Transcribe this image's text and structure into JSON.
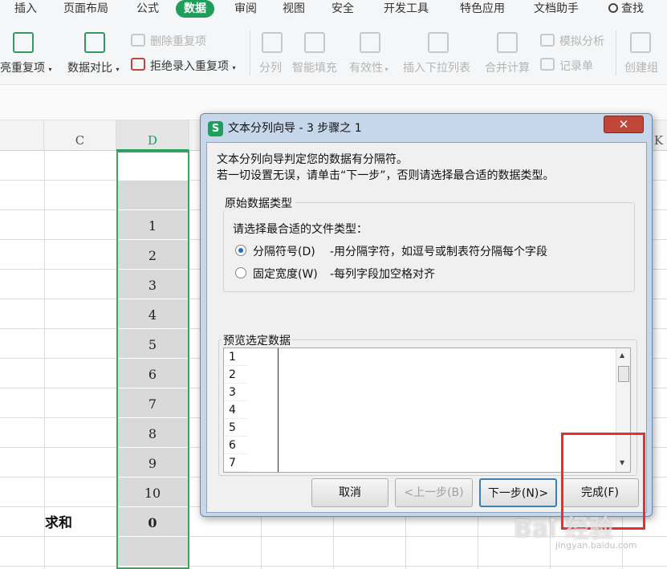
{
  "ribbon_tabs": [
    "插入",
    "页面布局",
    "公式",
    "数据",
    "审阅",
    "视图",
    "安全",
    "开发工具",
    "特色应用",
    "文档助手",
    "查找"
  ],
  "ribbon": {
    "highlight_dup": "亮重复项",
    "data_compare": "数据对比",
    "remove_dup": "删除重复项",
    "reject_dup": "拒绝录入重复项",
    "split": "分列",
    "smart_fill": "智能填充",
    "validity": "有效性",
    "insert_dropdown": "插入下拉列表",
    "merge_calc": "合并计算",
    "simulate": "模拟分析",
    "record_form": "记录单",
    "create_group": "创建组"
  },
  "sheet": {
    "columns": [
      "C",
      "D",
      "K"
    ],
    "d_values": [
      "",
      "",
      "1",
      "2",
      "3",
      "4",
      "5",
      "6",
      "7",
      "8",
      "9",
      "10",
      "0",
      ""
    ],
    "sum_label": "求和"
  },
  "dialog": {
    "title": "文本分列向导 - 3 步骤之 1",
    "close_glyph": "✕",
    "desc1": "文本分列向导判定您的数据有分隔符。",
    "desc2": "若一切设置无误，请单击“下一步”，否则请选择最合适的数据类型。",
    "group_title": "原始数据类型",
    "prompt": "请选择最合适的文件类型：",
    "option1": "分隔符号(D)",
    "option1_desc": "-用分隔字符，如逗号或制表符分隔每个字段",
    "option2": "固定宽度(W)",
    "option2_desc": "-每列字段加空格对齐",
    "selected_option": "分隔符号(D)",
    "preview_title": "预览选定数据",
    "preview_rows": [
      "1",
      "2",
      "3",
      "4",
      "5",
      "6",
      "7"
    ],
    "btn_cancel": "取消",
    "btn_prev": "<上一步(B)",
    "btn_next": "下一步(N)>",
    "btn_finish": "完成(F)"
  },
  "watermark": {
    "main": "Bai 经验",
    "sub": "jingyan.baidu.com"
  }
}
